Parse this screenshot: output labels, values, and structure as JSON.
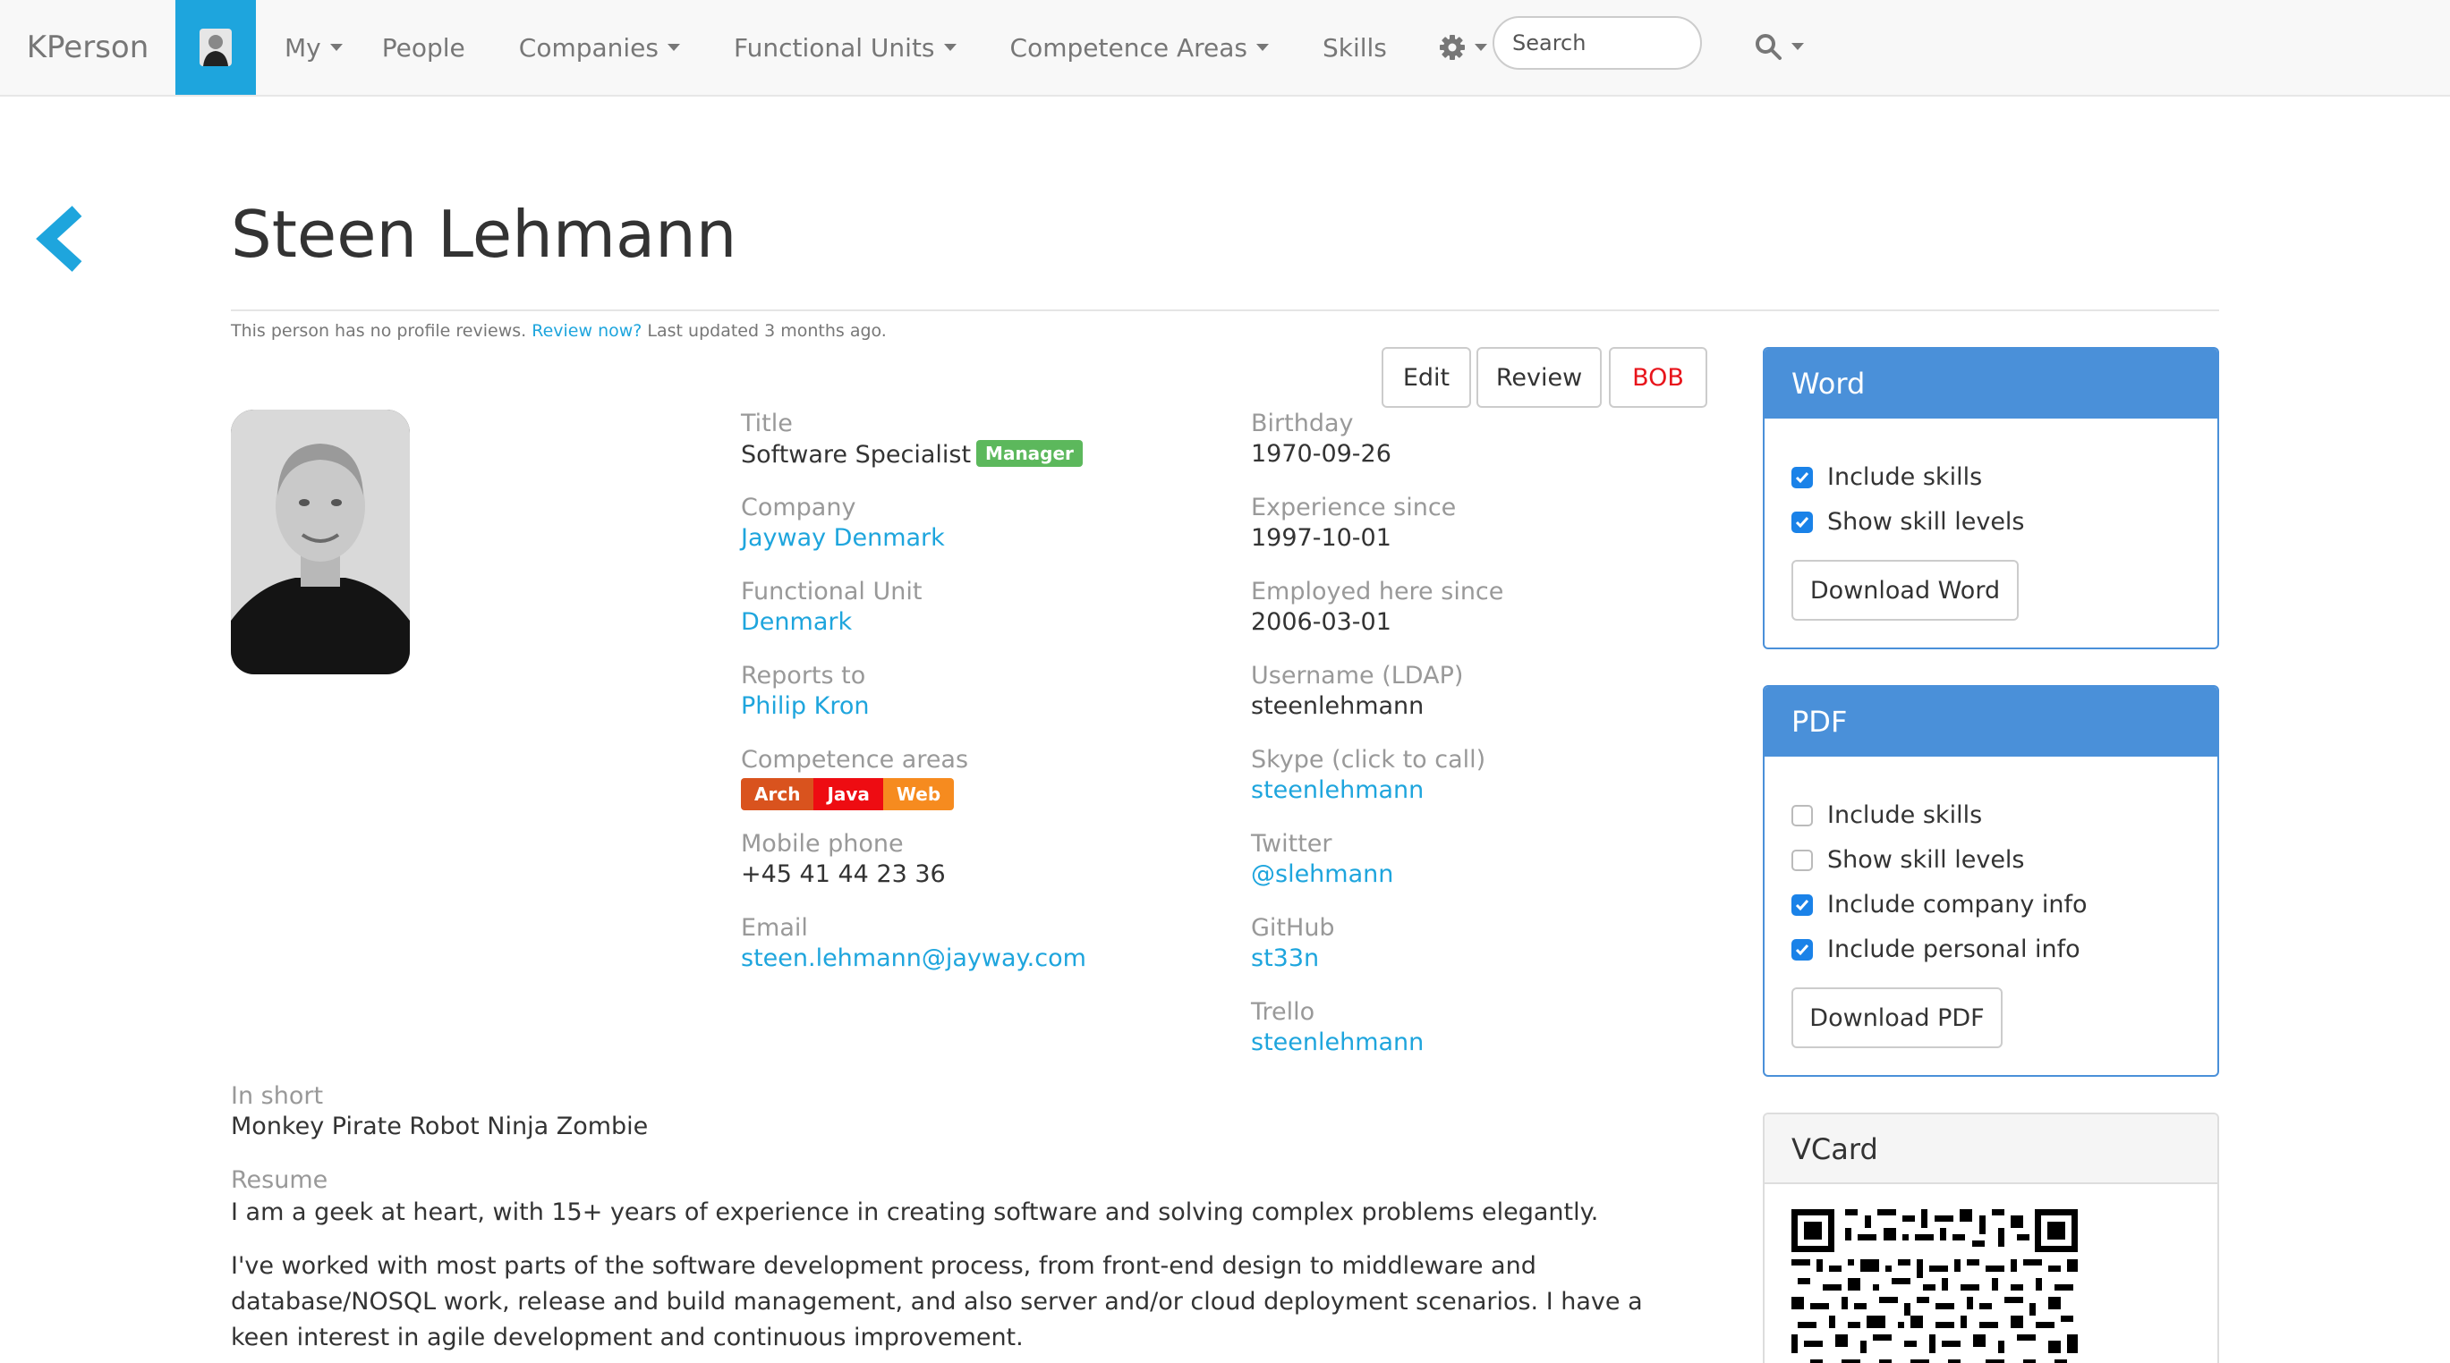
{
  "navbar": {
    "brand": "KPerson",
    "items": [
      "My",
      "People",
      "Companies",
      "Functional Units",
      "Competence Areas",
      "Skills"
    ],
    "search_placeholder": "Search"
  },
  "person": {
    "name": "Steen Lehmann",
    "review_note": {
      "prefix": "This person has no profile reviews.",
      "link": "Review now?",
      "suffix": "Last updated 3 months ago."
    }
  },
  "actions": {
    "edit": "Edit",
    "review": "Review",
    "bob": "BOB"
  },
  "fields_left": {
    "title": {
      "label": "Title",
      "value": "Software Specialist",
      "badge": "Manager"
    },
    "company": {
      "label": "Company",
      "value": "Jayway Denmark"
    },
    "functional_unit": {
      "label": "Functional Unit",
      "value": "Denmark"
    },
    "reports_to": {
      "label": "Reports to",
      "value": "Philip Kron"
    },
    "competence_areas": {
      "label": "Competence areas",
      "badges": [
        {
          "label": "Arch",
          "color": "#d9531e"
        },
        {
          "label": "Java",
          "color": "#ee0c12"
        },
        {
          "label": "Web",
          "color": "#f68b1f"
        }
      ]
    },
    "mobile": {
      "label": "Mobile phone",
      "value": "+45 41 44 23 36"
    },
    "email": {
      "label": "Email",
      "value": "steen.lehmann@jayway.com"
    }
  },
  "fields_right": {
    "birthday": {
      "label": "Birthday",
      "value": "1970-09-26"
    },
    "experience": {
      "label": "Experience since",
      "value": "1997-10-01"
    },
    "employed": {
      "label": "Employed here since",
      "value": "2006-03-01"
    },
    "username": {
      "label": "Username (LDAP)",
      "value": "steenlehmann"
    },
    "skype": {
      "label": "Skype (click to call)",
      "value": "steenlehmann"
    },
    "twitter": {
      "label": "Twitter",
      "value": "@slehmann"
    },
    "github": {
      "label": "GitHub",
      "value": "st33n"
    },
    "trello": {
      "label": "Trello",
      "value": "steenlehmann"
    }
  },
  "in_short": {
    "label": "In short",
    "value": "Monkey Pirate Robot Ninja Zombie"
  },
  "resume": {
    "label": "Resume",
    "paragraphs": [
      "I am a geek at heart, with 15+ years of experience in creating software and solving complex problems elegantly.",
      "I've worked with most parts of the software development process, from front-end design to middleware and database/NOSQL work, release and build management, and also server and/or cloud deployment scenarios. I have a keen interest in agile development and continuous improvement."
    ]
  },
  "word_panel": {
    "title": "Word",
    "options": [
      {
        "label": "Include skills",
        "checked": true
      },
      {
        "label": "Show skill levels",
        "checked": true
      }
    ],
    "button": "Download Word"
  },
  "pdf_panel": {
    "title": "PDF",
    "options": [
      {
        "label": "Include skills",
        "checked": false
      },
      {
        "label": "Show skill levels",
        "checked": false
      },
      {
        "label": "Include company info",
        "checked": true
      },
      {
        "label": "Include personal info",
        "checked": true
      }
    ],
    "button": "Download PDF"
  },
  "vcard_panel": {
    "title": "VCard"
  },
  "colors": {
    "accent": "#1ea5dd",
    "panel_blue": "#4a90d9",
    "manager_green": "#5cb85c",
    "bob_red": "#e8141b"
  }
}
